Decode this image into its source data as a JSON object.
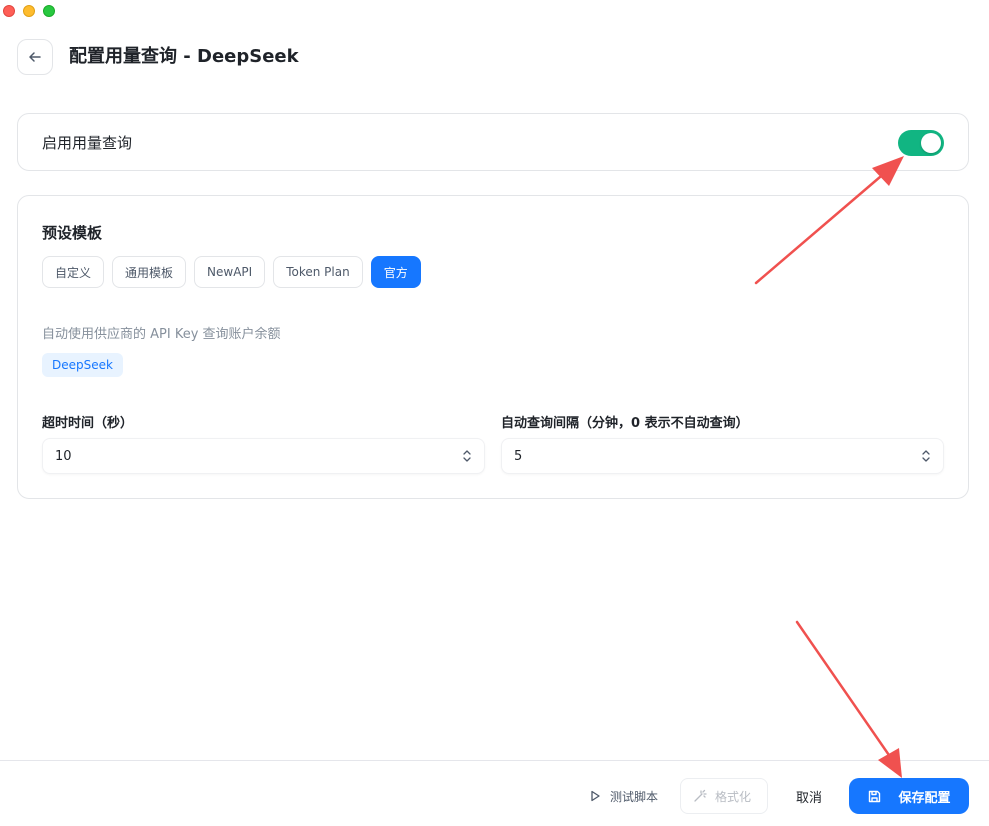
{
  "header": {
    "title": "配置用量查询 - DeepSeek"
  },
  "enable": {
    "label": "启用用量查询",
    "enabled": true
  },
  "template_section": {
    "title": "预设模板",
    "templates": [
      "自定义",
      "通用模板",
      "NewAPI",
      "Token Plan",
      "官方"
    ],
    "active_template": "官方",
    "description": "自动使用供应商的 API Key 查询账户余额",
    "provider_tag": "DeepSeek"
  },
  "fields": {
    "timeout": {
      "label": "超时时间（秒）",
      "value": "10"
    },
    "interval": {
      "label": "自动查询间隔（分钟，0 表示不自动查询）",
      "value": "5"
    }
  },
  "footer": {
    "run_label": "测试脚本",
    "format_label": "格式化",
    "cancel_label": "取消",
    "save_label": "保存配置"
  },
  "colors": {
    "accent": "#1677ff",
    "toggle_on": "#11b582",
    "annotation_arrow": "#f0514f"
  }
}
